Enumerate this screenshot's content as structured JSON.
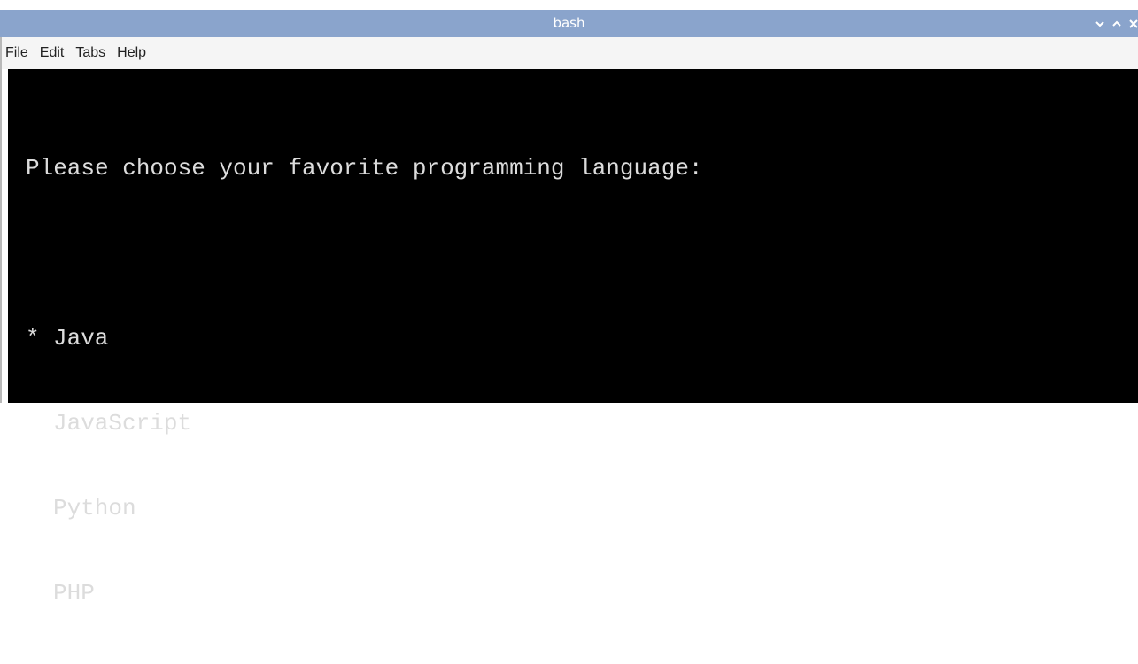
{
  "window": {
    "title": "bash"
  },
  "controls": {
    "minimize_icon": "chevron-down-icon",
    "maximize_icon": "chevron-up-icon",
    "close_icon": "close-icon"
  },
  "menu": {
    "items": [
      {
        "label": "File"
      },
      {
        "label": "Edit"
      },
      {
        "label": "Tabs"
      },
      {
        "label": "Help"
      }
    ]
  },
  "terminal": {
    "prompt": "Please choose your favorite programming language:",
    "options": [
      {
        "marker": "*",
        "label": "Java",
        "selected": true
      },
      {
        "marker": "",
        "label": "JavaScript",
        "selected": false
      },
      {
        "marker": "",
        "label": "Python",
        "selected": false
      },
      {
        "marker": "",
        "label": "PHP",
        "selected": false
      }
    ]
  },
  "colors": {
    "titlebar": "#8aa4cc",
    "menubar": "#f5f5f5",
    "terminal_bg": "#000000",
    "terminal_fg": "#dcdcdc"
  }
}
